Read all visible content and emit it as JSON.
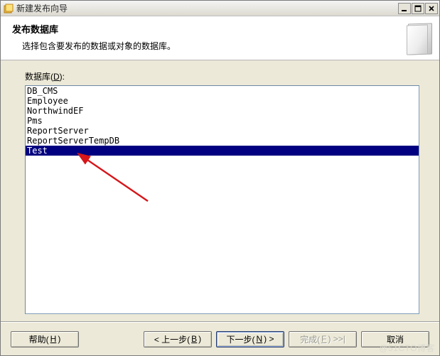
{
  "window": {
    "title": "新建发布向导"
  },
  "header": {
    "title": "发布数据库",
    "subtitle": "选择包含要发布的数据或对象的数据库。"
  },
  "field": {
    "label_pre": "数据库(",
    "label_key": "D",
    "label_post": "):"
  },
  "databases": [
    "DB_CMS",
    "Employee",
    "NorthwindEF",
    "Pms",
    "ReportServer",
    "ReportServerTempDB",
    "Test"
  ],
  "selected_index": 6,
  "buttons": {
    "help_pre": "帮助(",
    "help_key": "H",
    "help_post": ")",
    "back_pre": "< 上一步(",
    "back_key": "B",
    "back_post": ")",
    "next_pre": "下一步(",
    "next_key": "N",
    "next_post": ") >",
    "finish_pre": "完成(",
    "finish_key": "F",
    "finish_post": ") >>|",
    "cancel": "取消"
  },
  "watermark": "@51CTO博客"
}
